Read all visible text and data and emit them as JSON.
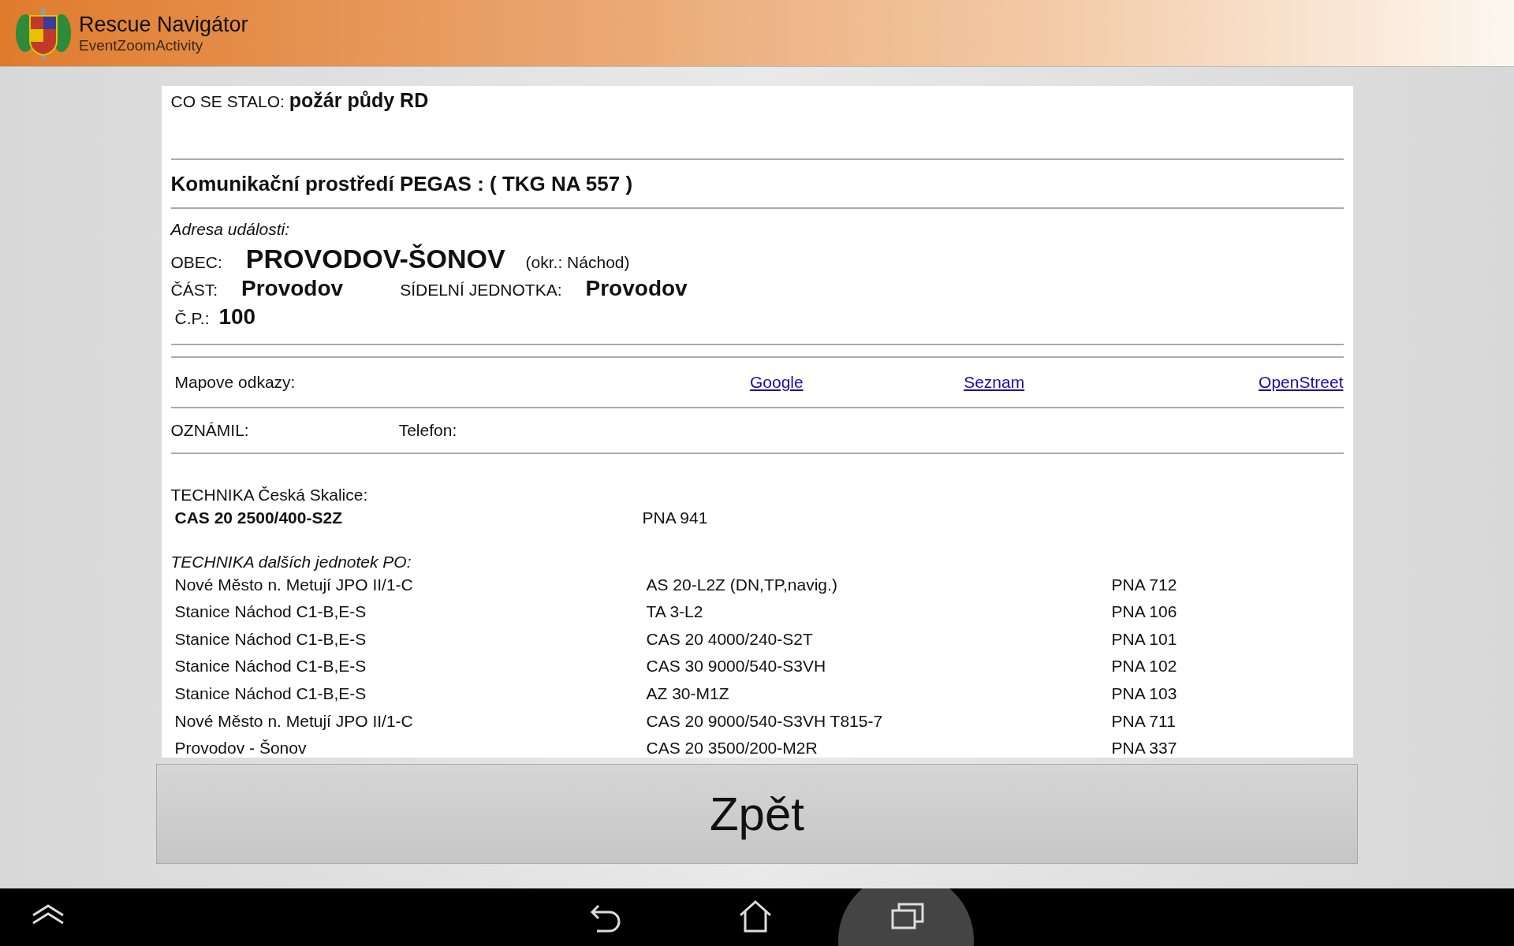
{
  "app_bar": {
    "title": "Rescue Navigátor",
    "subtitle": "EventZoomActivity"
  },
  "event": {
    "what_label": "CO SE STALO:",
    "what_value": "požár půdy RD",
    "comm_env": "Komunikační prostředí PEGAS : ( TKG NA 557 )",
    "address": {
      "heading": "Adresa události:",
      "obec_label": "OBEC:",
      "obec_value": "PROVODOV-ŠONOV",
      "district": "(okr.: Náchod)",
      "cast_label": "ČÁST:",
      "cast_value": "Provodov",
      "unit_label": "SÍDELNÍ JEDNOTKA:",
      "unit_value": "Provodov",
      "cp_label": "Č.P.:",
      "cp_value": "100"
    },
    "map_links": {
      "label": "Mapove odkazy:",
      "links": [
        "Google",
        "Seznam",
        "OpenStreet"
      ]
    },
    "reporter": {
      "label": "OZNÁMIL:",
      "phone_label": "Telefon:"
    },
    "own_equipment": {
      "heading": "TECHNIKA Česká Skalice:",
      "vehicle": "CAS 20 2500/400-S2Z",
      "plate": "PNA 941"
    },
    "other_equipment": {
      "heading": "TECHNIKA dalších jednotek PO:",
      "rows": [
        {
          "unit": "Nové Město n. Metují JPO II/1-C",
          "vehicle": "AS 20-L2Z (DN,TP,navig.)",
          "plate": "PNA 712"
        },
        {
          "unit": "Stanice Náchod C1-B,E-S",
          "vehicle": "TA 3-L2",
          "plate": "PNA 106"
        },
        {
          "unit": "Stanice Náchod C1-B,E-S",
          "vehicle": "CAS 20 4000/240-S2T",
          "plate": "PNA 101"
        },
        {
          "unit": "Stanice Náchod C1-B,E-S",
          "vehicle": "CAS 30 9000/540-S3VH",
          "plate": "PNA 102"
        },
        {
          "unit": "Stanice Náchod C1-B,E-S",
          "vehicle": "AZ 30-M1Z",
          "plate": "PNA 103"
        },
        {
          "unit": "Nové Město n. Metují JPO II/1-C",
          "vehicle": "CAS 20 9000/540-S3VH T815-7",
          "plate": "PNA 711"
        },
        {
          "unit": "Provodov - Šonov",
          "vehicle": "CAS 20 3500/200-M2R",
          "plate": "PNA 337"
        }
      ]
    }
  },
  "back_button": "Zpět"
}
